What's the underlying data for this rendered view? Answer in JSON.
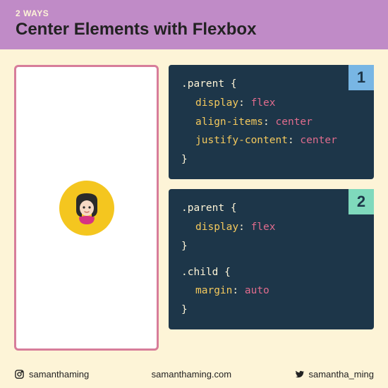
{
  "header": {
    "subtitle": "2 WAYS",
    "title": "Center Elements with Flexbox"
  },
  "code1": {
    "badge": "1",
    "selector": ".parent",
    "p1": "display",
    "v1": "flex",
    "p2": "align-items",
    "v2": "center",
    "p3": "justify-content",
    "v3": "center"
  },
  "code2": {
    "badge": "2",
    "sel_a": ".parent",
    "pa1": "display",
    "va1": "flex",
    "sel_b": ".child",
    "pb1": "margin",
    "vb1": "auto"
  },
  "footer": {
    "instagram": "samanthaming",
    "site": "samanthaming.com",
    "twitter": "samantha_ming"
  }
}
